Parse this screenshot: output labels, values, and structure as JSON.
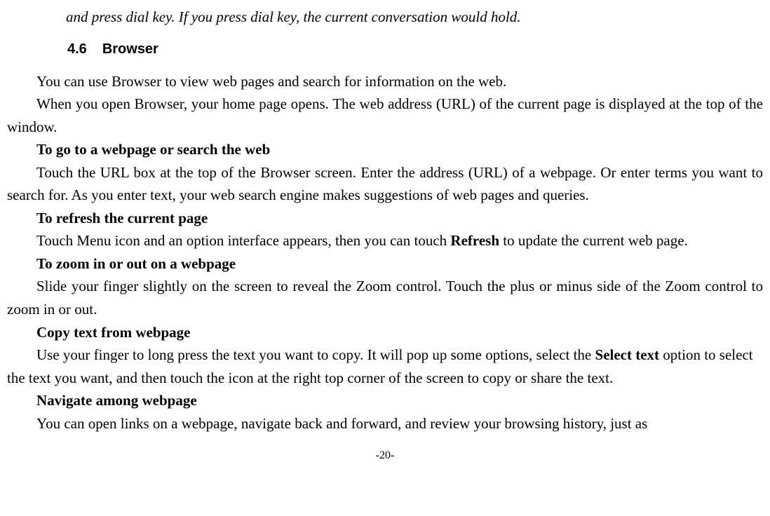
{
  "topItalic": "and press dial key. If you press dial key, the current conversation would hold.",
  "section": {
    "number": "4.6",
    "title": "Browser"
  },
  "p1": "You can use Browser to view web pages and search for information on the web.",
  "p2": "When you open Browser, your home page opens. The web address (URL) of the current page is displayed at the top of the window.",
  "h1": "To go to a webpage or search the web",
  "p3": "Touch the URL box at the top of the Browser screen. Enter the address (URL) of a webpage. Or enter terms you want to search for. As you enter text, your web search engine makes suggestions of web pages and queries.",
  "h2": "To refresh the current page",
  "p4a": "Touch Menu icon and an option interface appears, then you can touch ",
  "p4bold": "Refresh",
  "p4b": " to update the current web page.",
  "h3": "To zoom in or out on a webpage",
  "p5": "Slide your finger slightly on the screen to reveal the Zoom control. Touch the plus or minus side of the Zoom control to zoom in or out.",
  "h4": "Copy text from webpage",
  "p6a": "Use your finger to long press the text you want to copy. It will pop up some options, select the ",
  "p6bold": "Select text",
  "p6b": " option to select the text you want, and then touch the icon at the right top corner of the screen to copy or share the text.",
  "h5": "Navigate among webpage",
  "p7": "You can open links on a webpage, navigate back and forward, and review your browsing history, just as",
  "pageNumber": "-20-"
}
